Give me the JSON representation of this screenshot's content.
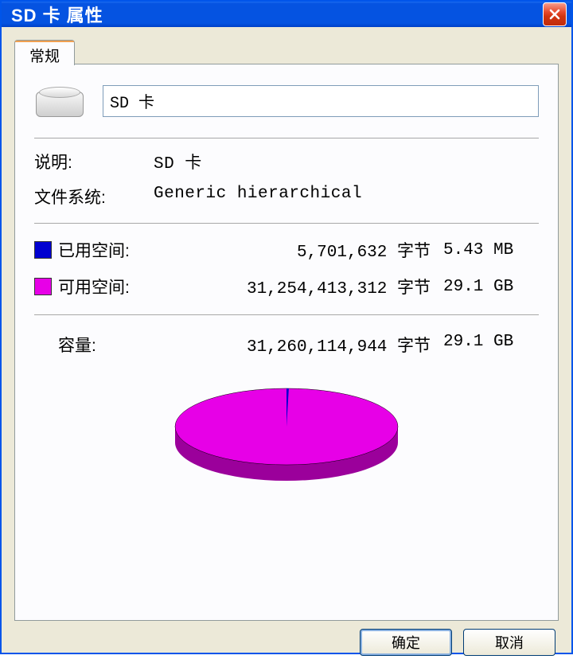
{
  "title": "SD 卡 属性",
  "tab": {
    "general": "常规"
  },
  "driveName": "SD 卡",
  "labels": {
    "description": "说明:",
    "filesystem": "文件系统:",
    "used": "已用空间:",
    "free": "可用空间:",
    "capacity": "容量:"
  },
  "values": {
    "description": "SD 卡",
    "filesystem": "Generic hierarchical",
    "usedBytes": "5,701,632 字节",
    "usedHuman": "5.43 MB",
    "freeBytes": "31,254,413,312 字节",
    "freeHuman": "29.1 GB",
    "capBytes": "31,260,114,944 字节",
    "capHuman": "29.1 GB"
  },
  "colors": {
    "used": "#0000D0",
    "free": "#E700E7",
    "freeDark": "#9B009B"
  },
  "buttons": {
    "ok": "确定",
    "cancel": "取消"
  },
  "chart_data": {
    "type": "pie",
    "title": "",
    "series": [
      {
        "name": "已用空间",
        "value": 5701632,
        "color": "#0000D0"
      },
      {
        "name": "可用空间",
        "value": 31254413312,
        "color": "#E700E7"
      }
    ]
  }
}
